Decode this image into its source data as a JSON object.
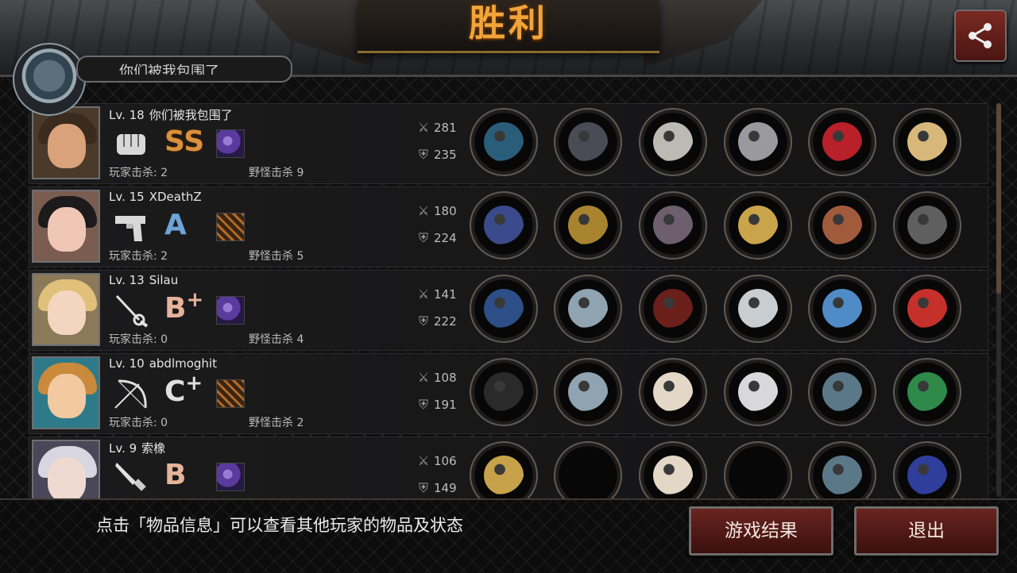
{
  "title": "胜利",
  "top_player_name": "你们被我包围了",
  "share_icon": "share-icon",
  "players": [
    {
      "level": "Lv. 18",
      "name": "你们被我包围了",
      "weapon_icon": "fist-icon",
      "grade": "SS",
      "grade_plus": "",
      "grade_color": "gold",
      "skill": "purple",
      "player_kills": "玩家击杀: 2",
      "monster_kills": "野怪击杀 9",
      "attack": "281",
      "defense": "235",
      "portrait": {
        "hair": "#3b2a1e",
        "skin": "#d9a27b",
        "bg": "#4a3a2a"
      },
      "items": [
        "#2a5d7a",
        "#4b4b55",
        "#bdb9b3",
        "#9a9a9e",
        "#b8202a",
        "#d8b87a"
      ]
    },
    {
      "level": "Lv. 15",
      "name": "XDeathZ",
      "weapon_icon": "pistol-icon",
      "grade": "A",
      "grade_plus": "",
      "grade_color": "blue",
      "skill": "orange",
      "player_kills": "玩家击杀: 2",
      "monster_kills": "野怪击杀 5",
      "attack": "180",
      "defense": "224",
      "portrait": {
        "hair": "#1d1a1c",
        "skin": "#f0c7b4",
        "bg": "#7a5d50"
      },
      "items": [
        "#3a4a8a",
        "#a8842e",
        "#6e5f6e",
        "#c9a44a",
        "#a25a3c",
        "#5f5f60"
      ]
    },
    {
      "level": "Lv. 13",
      "name": "Silau",
      "weapon_icon": "rapier-icon",
      "grade": "B",
      "grade_plus": "+",
      "grade_color": "peach",
      "skill": "purple",
      "player_kills": "玩家击杀: 0",
      "monster_kills": "野怪击杀 4",
      "attack": "141",
      "defense": "222",
      "portrait": {
        "hair": "#e0c07a",
        "skin": "#f4d6c0",
        "bg": "#8a7a5a"
      },
      "items": [
        "#2d4e86",
        "#8fa3b0",
        "#6a1f1a",
        "#c8cdd2",
        "#4f8cc7",
        "#c6302a"
      ]
    },
    {
      "level": "Lv. 10",
      "name": "abdlmoghit",
      "weapon_icon": "bow-icon",
      "grade": "C",
      "grade_plus": "+",
      "grade_color": "silver",
      "skill": "orange",
      "player_kills": "玩家击杀: 0",
      "monster_kills": "野怪击杀 2",
      "attack": "108",
      "defense": "191",
      "portrait": {
        "hair": "#c98a3b",
        "skin": "#f2c9a0",
        "bg": "#2f7a8a"
      },
      "items": [
        "#2a2a2a",
        "#8fa3b0",
        "#e3d7c8",
        "#d8d8da",
        "#5b7888",
        "#2f8a4a"
      ]
    },
    {
      "level": "Lv. 9",
      "name": "索橡",
      "weapon_icon": "dagger-icon",
      "grade": "B",
      "grade_plus": "",
      "grade_color": "peach",
      "skill": "purple",
      "player_kills": "",
      "monster_kills": "",
      "attack": "106",
      "defense": "149",
      "portrait": {
        "hair": "#d8d6e0",
        "skin": "#eedad0",
        "bg": "#4a4858"
      },
      "items": [
        "#c7a24a",
        "",
        "#e3d7c8",
        "",
        "#5b7888",
        "#2e3e9a"
      ]
    }
  ],
  "hint_text": "点击「物品信息」可以查看其他玩家的物品及状态",
  "buttons": {
    "results": "游戏结果",
    "exit": "退出"
  }
}
